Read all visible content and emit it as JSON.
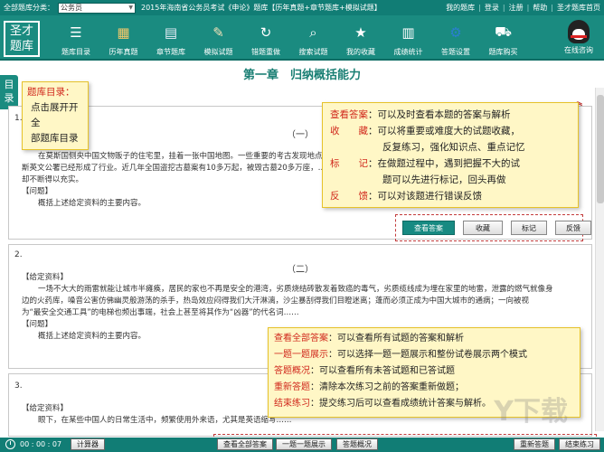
{
  "topbar": {
    "category_label": "全部题库分类：",
    "category_value": "公务员",
    "title": "2015年海南省公务员考试《申论》题库【历年真题+章节题库+模拟试题】",
    "links": [
      "我的题库",
      "登录",
      "注册",
      "帮助",
      "圣才题库首页"
    ]
  },
  "logo": {
    "line1": "圣才",
    "line2": "题库"
  },
  "toolbar": [
    {
      "icon": "list-icon",
      "label": "题库目录",
      "color": "#ffffff"
    },
    {
      "icon": "calendar-icon",
      "label": "历年真题",
      "color": "#f3c86a"
    },
    {
      "icon": "book-icon",
      "label": "章节题库",
      "color": "#e8eef8"
    },
    {
      "icon": "pencil-icon",
      "label": "模拟试题",
      "color": "#f2e2b8"
    },
    {
      "icon": "redo-icon",
      "label": "错题重做",
      "color": "#ffffff"
    },
    {
      "icon": "search-icon",
      "label": "搜索试题",
      "color": "#ffffff"
    },
    {
      "icon": "star-icon",
      "label": "我的收藏",
      "color": "#ffffff"
    },
    {
      "icon": "chart-icon",
      "label": "成绩统计",
      "color": "#ffffff"
    },
    {
      "icon": "gear-icon",
      "label": "答题设置",
      "color": "#2a7fd0"
    },
    {
      "icon": "cart-icon",
      "label": "题库购买",
      "color": "#ffffff"
    }
  ],
  "qq": {
    "label": "在线咨询"
  },
  "sidetab": "目录",
  "chapter_title": "第一章　归纳概括能力",
  "questions": [
    {
      "num": "1.",
      "sub": "（一）",
      "lines": [
        "【给定资料】",
        "在莫斯国侧央中国文物贩子的住宅里，挂着一张中国地图。一些重要的考古发现地点…",
        "斯英文公署已经形成了行业。近几年全国盗挖古墓案有10多万起，被毁古墓20多万座，…",
        "却不断得以充实。",
        "【问题】",
        "概括上述给定资料的主要内容。"
      ]
    },
    {
      "num": "2.",
      "sub": "（二）",
      "lines": [
        "【给定资料】",
        "一场不大大的雨雷就能让城市半瘫痪，居民的家也不再是安全的港湾，劣质烧结砖散发着致癌的毒气，劣质缆线成为埋在家里的地雷，泄露的燃气就像身",
        "边的火药库，噪音公害仿佛幽灵般游荡的杀手，热岛效应闷得我们大汗淋漓，沙尘暴刮得我们目瞪迷离；蓬而必须正成为中国大城市的通病；一向被视",
        "为“最安全交通工具”的电梯也频出事端，社会上甚至将其作为“凶器”的代名词……",
        "【问题】",
        "概括上述给定资料的主要内容。"
      ]
    },
    {
      "num": "3.",
      "sub": "（三）",
      "lines": [
        "【给定资料】",
        "眼下，在某些中国人的日常生活中，频繁使用外来语，尤其是英语缩写……"
      ]
    }
  ],
  "q1_buttons": [
    "查看答案",
    "收藏",
    "标记",
    "反馈"
  ],
  "callout_top": [
    {
      "key": "查看答案",
      "text": "：可以及时查看本题的答案与解析"
    },
    {
      "key": "收　　藏",
      "text": "：可以将重要或难度大的试题收藏，"
    },
    {
      "key": "",
      "text": "反复练习，强化知识点、重点记忆"
    },
    {
      "key": "标　　记",
      "text": "：在做题过程中，遇到把握不大的试"
    },
    {
      "key": "",
      "text": "题可以先进行标记，回头再做"
    },
    {
      "key": "反　　馈",
      "text": "：可以对该题进行错误反馈"
    }
  ],
  "callout_left": [
    "题库目录：",
    "点击展开开全",
    "部题库目录"
  ],
  "callout_bottom": [
    {
      "key": "查看全部答案",
      "text": "：可以查看所有试题的答案和解析"
    },
    {
      "key": "一题一题展示",
      "text": "：可以选择一题一题展示和整份试卷展示两个模式"
    },
    {
      "key": "答题概况",
      "text": "：可以查看所有未答试题和已答试题"
    },
    {
      "key": "重新答题",
      "text": "：清除本次练习之前的答案重新做题；"
    },
    {
      "key": "结束练习",
      "text": "：提交练习后可以查看成绩统计答案与解析。"
    }
  ],
  "statusbar": {
    "timer": "00 : 00 : 07",
    "calculator": "计算器",
    "view_all": "查看全部答案",
    "one_by_one": "一题一题展示",
    "overview": "答题概况",
    "restart": "重新答题",
    "finish": "结束练习"
  },
  "watermark": "Y下载"
}
